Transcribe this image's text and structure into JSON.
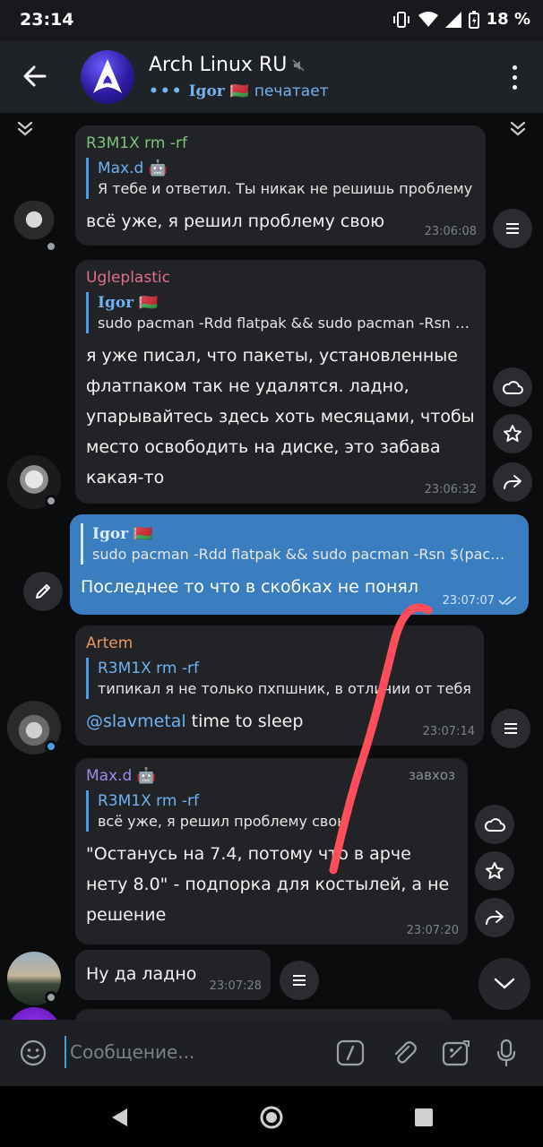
{
  "status_bar": {
    "time": "23:14",
    "battery": "18 %"
  },
  "header": {
    "title": "Arch Linux RU",
    "typing_dots": "•••",
    "typing_user": "Igor 🇧🇾",
    "typing_status": "печатает"
  },
  "messages": [
    {
      "sender": "R3M1X rm -rf",
      "sender_color": "#7dc47a",
      "quote_name": "Max.d 🤖",
      "quote_text": "Я тебе и ответил. Ты никак не решишь проблему",
      "text": "всё уже, я решил проблему свою",
      "time": "23:06:08"
    },
    {
      "sender": "Ugleplastic",
      "sender_color": "#e16f8f",
      "quote_name": "Igor 🇧🇾",
      "quote_text": "sudo pacman -Rdd flatpak && sudo pacman -Rsn $(pacman",
      "text": "я уже писал, что пакеты, установленные флатпаком так не удалятся. ладно, упарывайтесь здесь хоть месяцами, чтобы место освободить на диске, это забава какая-то",
      "time": "23:06:32"
    },
    {
      "quote_name": "Igor 🇧🇾",
      "quote_text": "sudo pacman -Rdd flatpak && sudo pacman -Rsn $(pacman",
      "text": "Последнее то что в скобках не понял",
      "time": "23:07:07"
    },
    {
      "sender": "Artem",
      "sender_color": "#e49a5e",
      "quote_name": "R3M1X rm -rf",
      "quote_text": "типикал я не только пхпшник, в отличии от тебя",
      "mention": "@slavmetal",
      "text": " time to sleep",
      "time": "23:07:14"
    },
    {
      "sender": "Max.d 🤖",
      "sender_color": "#9b8ce6",
      "extra_label": "завхоз",
      "quote_name": "R3M1X rm -rf",
      "quote_text": "всё уже, я решил проблему свою",
      "text": "\"Останусь на 7.4, потому что в арче нету 8.0\" - подпорка для костылей, а не решение",
      "time": "23:07:20"
    },
    {
      "text": "Ну да ладно",
      "time": "23:07:28"
    }
  ],
  "input": {
    "placeholder": "Сообщение..."
  },
  "colors": {
    "accent": "#4a9be8",
    "own_bubble": "#3a7ec0",
    "bubble": "#212327",
    "annotation": "#ff4d5b"
  }
}
